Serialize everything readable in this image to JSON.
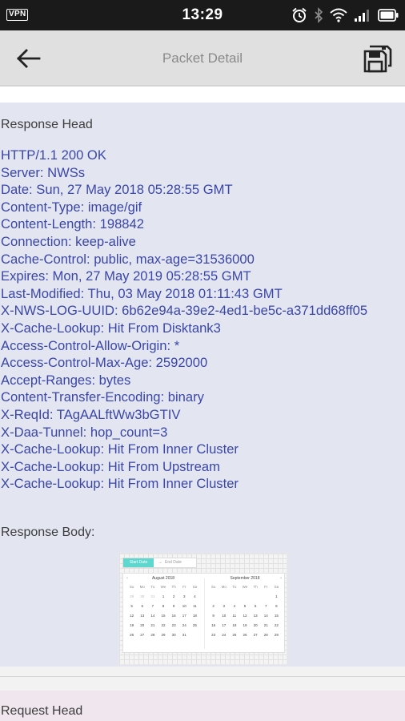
{
  "status_bar": {
    "vpn_label": "VPN",
    "time": "13:29",
    "icons": [
      "alarm-icon",
      "bluetooth-icon",
      "wifi-icon",
      "signal-icon",
      "battery-icon"
    ]
  },
  "toolbar": {
    "title": "Packet Detail",
    "back_icon": "back-arrow-icon",
    "save_icon": "save-icon"
  },
  "response": {
    "head_title": "Response Head",
    "header_lines": [
      "HTTP/1.1 200 OK",
      "Server: NWSs",
      "Date: Sun, 27 May 2018 05:28:55 GMT",
      "Content-Type: image/gif",
      "Content-Length: 198842",
      "Connection: keep-alive",
      "Cache-Control: public, max-age=31536000",
      "Expires: Mon, 27 May 2019 05:28:55 GMT",
      "Last-Modified: Thu, 03 May 2018 01:11:43 GMT",
      "X-NWS-LOG-UUID: 6b62e94a-39e2-4ed1-be5c-a371dd68ff05",
      "X-Cache-Lookup: Hit From Disktank3",
      "Access-Control-Allow-Origin: *",
      "Access-Control-Max-Age: 2592000",
      "Accept-Ranges: bytes",
      "Content-Transfer-Encoding: binary",
      "X-ReqId: TAgAALftWw3bGTIV",
      "X-Daa-Tunnel: hop_count=3",
      "X-Cache-Lookup: Hit From Inner Cluster",
      "X-Cache-Lookup: Hit From Upstream",
      "X-Cache-Lookup: Hit From Inner Cluster"
    ],
    "body_title": "Response Body:",
    "body_preview": {
      "start_date_label": "Start Date",
      "end_date_label": "End Date",
      "months": [
        {
          "name": "August 2018",
          "weekdays": [
            "Su",
            "Mo",
            "Tu",
            "We",
            "Th",
            "Fr",
            "Sa"
          ],
          "days": [
            "29",
            "30",
            "31",
            "1",
            "2",
            "3",
            "4",
            "5",
            "6",
            "7",
            "8",
            "9",
            "10",
            "11",
            "12",
            "13",
            "14",
            "15",
            "16",
            "17",
            "18",
            "19",
            "20",
            "21",
            "22",
            "23",
            "24",
            "25",
            "26",
            "27",
            "28",
            "29",
            "30",
            "31",
            ""
          ]
        },
        {
          "name": "September 2018",
          "weekdays": [
            "Su",
            "Mo",
            "Tu",
            "We",
            "Th",
            "Fr",
            "Sa"
          ],
          "days": [
            "",
            "",
            "",
            "",
            "",
            "",
            "1",
            "2",
            "3",
            "4",
            "5",
            "6",
            "7",
            "8",
            "9",
            "10",
            "11",
            "12",
            "13",
            "14",
            "15",
            "16",
            "17",
            "18",
            "19",
            "20",
            "21",
            "22",
            "23",
            "24",
            "25",
            "26",
            "27",
            "28",
            "29"
          ]
        }
      ]
    }
  },
  "request": {
    "head_title": "Request Head"
  }
}
